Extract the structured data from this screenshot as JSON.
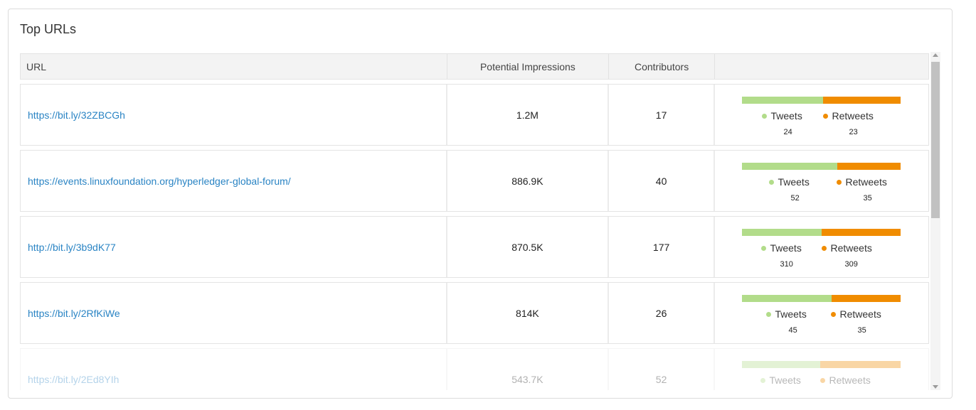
{
  "panel": {
    "title": "Top URLs"
  },
  "table": {
    "headers": {
      "url": "URL",
      "impressions": "Potential Impressions",
      "contributors": "Contributors",
      "bar": ""
    },
    "rows": [
      {
        "url": "https://bit.ly/32ZBCGh",
        "impressions": "1.2M",
        "contributors": "17",
        "tweets_label": "Tweets",
        "retweets_label": "Retweets",
        "tweets": "24",
        "retweets": "23",
        "tweets_share": 0.511
      },
      {
        "url": "https://events.linuxfoundation.org/hyperledger-global-forum/",
        "impressions": "886.9K",
        "contributors": "40",
        "tweets_label": "Tweets",
        "retweets_label": "Retweets",
        "tweets": "52",
        "retweets": "35",
        "tweets_share": 0.598
      },
      {
        "url": "http://bit.ly/3b9dK77",
        "impressions": "870.5K",
        "contributors": "177",
        "tweets_label": "Tweets",
        "retweets_label": "Retweets",
        "tweets": "310",
        "retweets": "309",
        "tweets_share": 0.501
      },
      {
        "url": "https://bit.ly/2RfKiWe",
        "impressions": "814K",
        "contributors": "26",
        "tweets_label": "Tweets",
        "retweets_label": "Retweets",
        "tweets": "45",
        "retweets": "35",
        "tweets_share": 0.563
      },
      {
        "url": "https://bit.ly/2Ed8YIh",
        "impressions": "543.7K",
        "contributors": "52",
        "tweets_label": "Tweets",
        "retweets_label": "Retweets",
        "tweets": "",
        "retweets": "",
        "tweets_share": 0.49
      }
    ]
  },
  "colors": {
    "tweets": "#b2dc8a",
    "retweets": "#f08c00",
    "link": "#2a84c4"
  },
  "icons": {
    "scroll_up": "scroll-up-arrow-icon",
    "scroll_down": "scroll-down-arrow-icon"
  }
}
